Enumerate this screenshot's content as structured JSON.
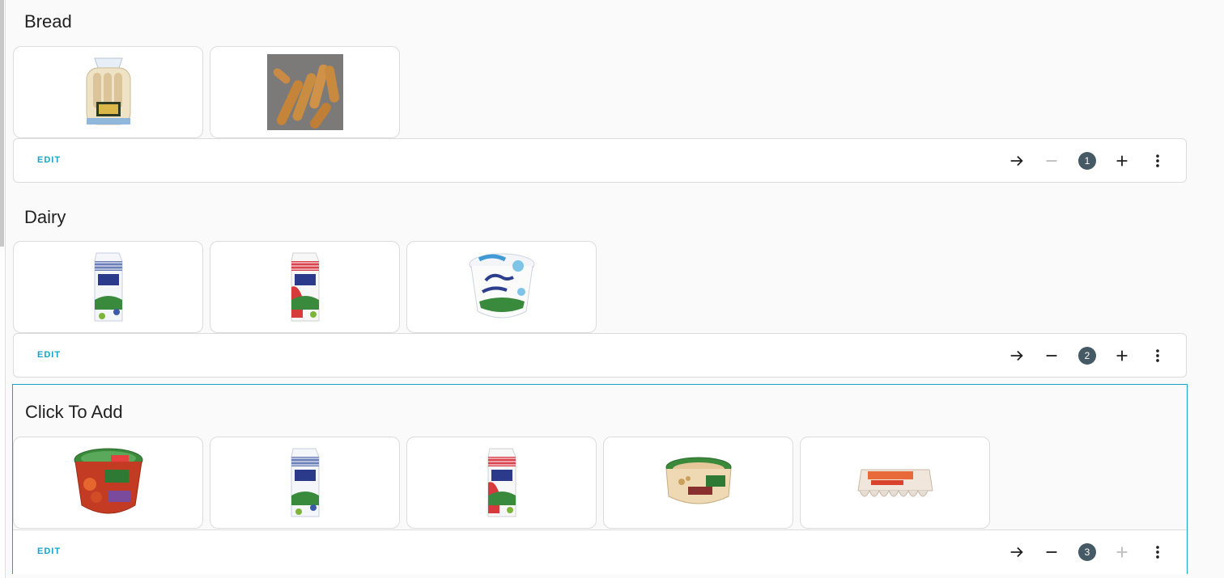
{
  "sections": [
    {
      "title": "Bread",
      "count": "1",
      "minus_disabled": true,
      "plus_disabled": false,
      "tiles": [
        {
          "icon": "bread-bag-image"
        },
        {
          "icon": "baguettes-image"
        }
      ]
    },
    {
      "title": "Dairy",
      "count": "2",
      "minus_disabled": false,
      "plus_disabled": false,
      "tiles": [
        {
          "icon": "milk-carton-blue-image"
        },
        {
          "icon": "milk-carton-red-image"
        },
        {
          "icon": "cottage-cheese-tub-image"
        }
      ]
    },
    {
      "title": "Click To Add",
      "count": "3",
      "minus_disabled": false,
      "plus_disabled": true,
      "tiles": [
        {
          "icon": "tomato-salad-tub-image"
        },
        {
          "icon": "milk-carton-blue-image"
        },
        {
          "icon": "milk-carton-red-image"
        },
        {
          "icon": "hummus-tub-image"
        },
        {
          "icon": "egg-carton-image"
        }
      ]
    }
  ],
  "edit_label": "EDIT",
  "colors": {
    "accent": "#1aa3c6",
    "badge": "#455a64",
    "disabled": "#bdbdbd"
  }
}
